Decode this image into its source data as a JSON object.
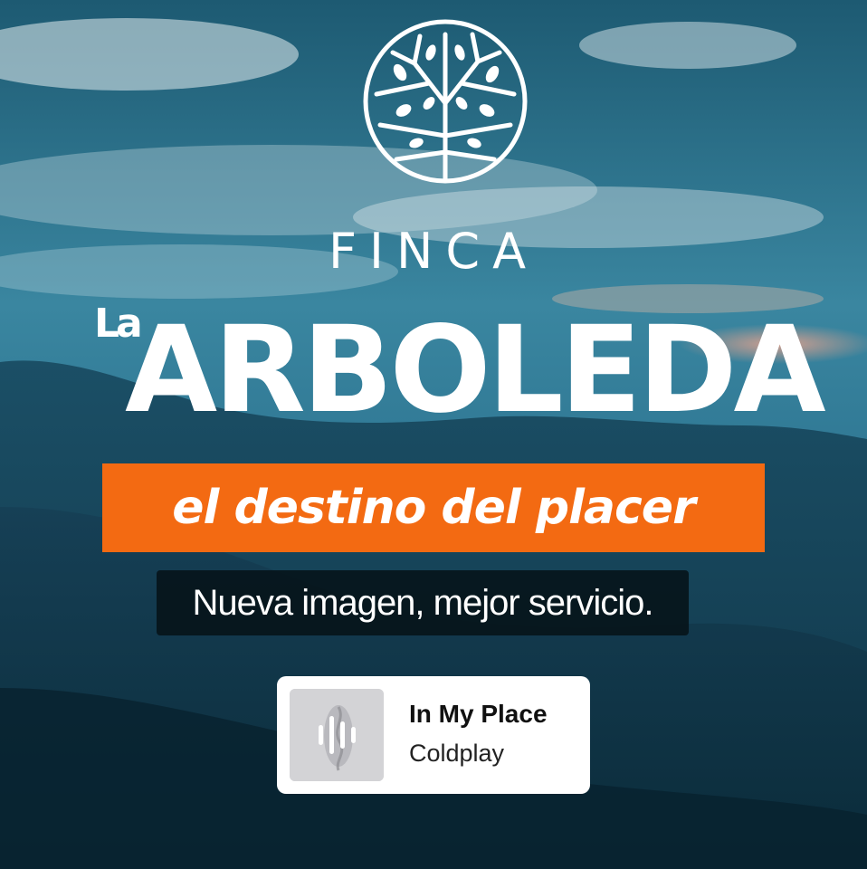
{
  "logo": {
    "icon": "tree-in-circle-icon",
    "color": "#ffffff"
  },
  "brand": {
    "finca": "FINCA",
    "la": "La",
    "name": "ARBOLEDA"
  },
  "tagline": {
    "text": "el destino del placer",
    "background": "#f36a12"
  },
  "subtitle": {
    "text": "Nueva imagen, mejor servicio."
  },
  "music": {
    "title": "In My Place",
    "artist": "Coldplay",
    "icon": "audio-wave-icon"
  }
}
